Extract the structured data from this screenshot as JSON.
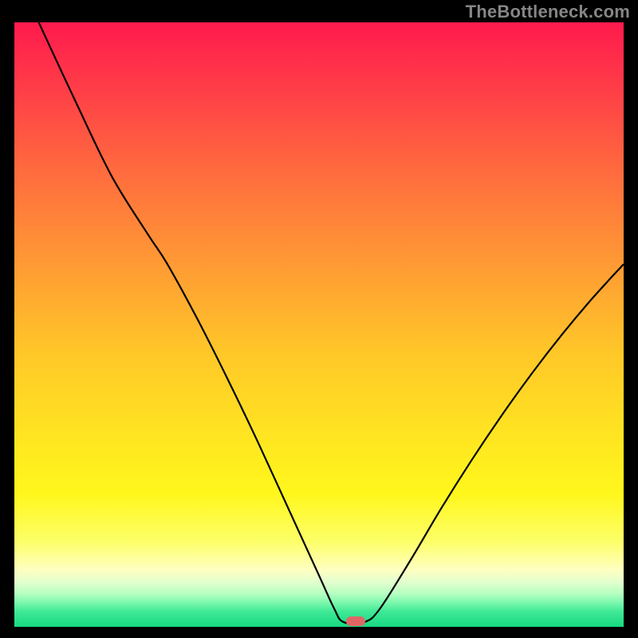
{
  "watermark": "TheBottleneck.com",
  "chart_data": {
    "type": "line",
    "title": "",
    "xlabel": "",
    "ylabel": "",
    "xlim": [
      0,
      100
    ],
    "ylim": [
      0,
      100
    ],
    "background_gradient": {
      "stops": [
        {
          "offset": 0.0,
          "color": "#ff1a4d"
        },
        {
          "offset": 0.1,
          "color": "#ff3a48"
        },
        {
          "offset": 0.25,
          "color": "#ff6c3e"
        },
        {
          "offset": 0.4,
          "color": "#ff9a34"
        },
        {
          "offset": 0.55,
          "color": "#ffc828"
        },
        {
          "offset": 0.7,
          "color": "#ffe820"
        },
        {
          "offset": 0.78,
          "color": "#fff71c"
        },
        {
          "offset": 0.86,
          "color": "#fdff6a"
        },
        {
          "offset": 0.905,
          "color": "#feffc0"
        },
        {
          "offset": 0.925,
          "color": "#e4ffce"
        },
        {
          "offset": 0.945,
          "color": "#b6ffc2"
        },
        {
          "offset": 0.96,
          "color": "#7bf8ad"
        },
        {
          "offset": 0.975,
          "color": "#3fe896"
        },
        {
          "offset": 1.0,
          "color": "#17d981"
        }
      ]
    },
    "series": [
      {
        "name": "bottleneck-curve",
        "color": "#000000",
        "stroke_width": 2.2,
        "points": [
          {
            "x": 4.0,
            "y": 100.0
          },
          {
            "x": 10.0,
            "y": 87.0
          },
          {
            "x": 16.0,
            "y": 74.5
          },
          {
            "x": 22.0,
            "y": 64.8
          },
          {
            "x": 25.0,
            "y": 60.2
          },
          {
            "x": 30.0,
            "y": 51.0
          },
          {
            "x": 35.0,
            "y": 41.0
          },
          {
            "x": 40.0,
            "y": 30.5
          },
          {
            "x": 45.0,
            "y": 19.5
          },
          {
            "x": 50.0,
            "y": 8.5
          },
          {
            "x": 52.5,
            "y": 3.0
          },
          {
            "x": 54.0,
            "y": 0.8
          },
          {
            "x": 57.5,
            "y": 0.8
          },
          {
            "x": 60.0,
            "y": 3.0
          },
          {
            "x": 65.0,
            "y": 11.0
          },
          {
            "x": 70.0,
            "y": 19.5
          },
          {
            "x": 75.0,
            "y": 27.5
          },
          {
            "x": 80.0,
            "y": 35.0
          },
          {
            "x": 85.0,
            "y": 42.0
          },
          {
            "x": 90.0,
            "y": 48.5
          },
          {
            "x": 95.0,
            "y": 54.5
          },
          {
            "x": 100.0,
            "y": 60.0
          }
        ]
      }
    ],
    "min_marker": {
      "x": 56.0,
      "y": 0.9,
      "color": "#e06666"
    }
  }
}
